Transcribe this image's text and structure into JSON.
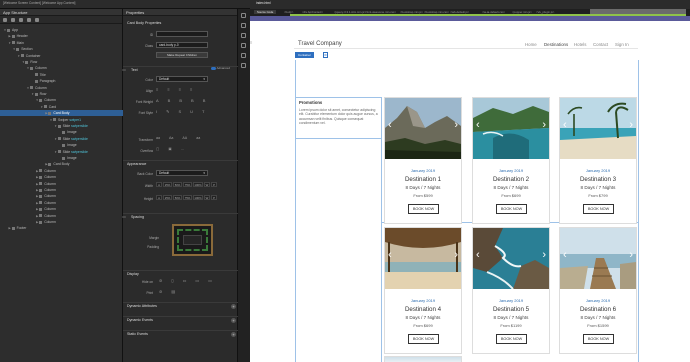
{
  "topbar": {
    "items": [
      "[Welcome Screen Content]",
      "[Welcome App Content]"
    ]
  },
  "left_panel": {
    "title": "App Structure",
    "rows": [
      {
        "label": "App",
        "indent": 0,
        "arrow": "▼"
      },
      {
        "label": "Header",
        "indent": 1,
        "arrow": "▶"
      },
      {
        "label": "Main",
        "indent": 1,
        "arrow": "▼"
      },
      {
        "label": "Section",
        "indent": 2,
        "arrow": "▼"
      },
      {
        "label": "Container",
        "indent": 3,
        "arrow": "▼"
      },
      {
        "label": "Row",
        "indent": 4,
        "arrow": "▼"
      },
      {
        "label": "Column",
        "indent": 5,
        "arrow": "▼"
      },
      {
        "label": "Title",
        "indent": 6,
        "arrow": ""
      },
      {
        "label": "Paragraph",
        "indent": 6,
        "arrow": ""
      },
      {
        "label": "Column",
        "indent": 5,
        "arrow": "▼"
      },
      {
        "label": "Row",
        "indent": 6,
        "arrow": "▼"
      },
      {
        "label": "Column",
        "indent": 7,
        "arrow": "▼"
      },
      {
        "label": "Card",
        "indent": 8,
        "arrow": "▼"
      },
      {
        "label": "Card Body",
        "indent": 9,
        "arrow": "▶",
        "selected": true
      },
      {
        "label": "Swiper",
        "suffix": "swiper1",
        "indent": 10,
        "arrow": "▼"
      },
      {
        "label": "Slide",
        "suffix": "swiperslide",
        "indent": 11,
        "arrow": "▼"
      },
      {
        "label": "Image",
        "indent": 12,
        "arrow": ""
      },
      {
        "label": "Slide",
        "suffix": "swiperslide",
        "indent": 11,
        "arrow": "▼"
      },
      {
        "label": "Image",
        "indent": 12,
        "arrow": ""
      },
      {
        "label": "Slide",
        "suffix": "swiperslide",
        "indent": 11,
        "arrow": "▼"
      },
      {
        "label": "Image",
        "indent": 12,
        "arrow": ""
      },
      {
        "label": "Card Body",
        "indent": 9,
        "arrow": "▶"
      },
      {
        "label": "Column",
        "indent": 7,
        "arrow": "▶"
      },
      {
        "label": "Column",
        "indent": 7,
        "arrow": "▶"
      },
      {
        "label": "Column",
        "indent": 7,
        "arrow": "▶"
      },
      {
        "label": "Column",
        "indent": 7,
        "arrow": "▶"
      },
      {
        "label": "Column",
        "indent": 7,
        "arrow": "▶"
      },
      {
        "label": "Column",
        "indent": 7,
        "arrow": "▶"
      },
      {
        "label": "Column",
        "indent": 7,
        "arrow": "▶"
      },
      {
        "label": "Column",
        "indent": 7,
        "arrow": "▶"
      },
      {
        "label": "Column",
        "indent": 7,
        "arrow": "▶"
      },
      {
        "label": "Footer",
        "indent": 1,
        "arrow": "▶"
      }
    ]
  },
  "props": {
    "title": "Properties",
    "card_body_properties": "Card Body Properties",
    "id_label": "ID",
    "id_value": "",
    "class_label": "Class",
    "class_value": "card-body p-0",
    "make_repeat_btn": "Make Repeat Children",
    "text_section": "Text",
    "advanced": "Advanced",
    "color_label": "Color",
    "color_value": "Default",
    "align_label": "Align",
    "font_weight_label": "Font Weight",
    "font_style_label": "Font Style",
    "transform_label": "Transform",
    "overflow_label": "Overflow",
    "appearance_section": "Appearance",
    "back_color_label": "Back Color",
    "back_color_value": "Default",
    "width_label": "Width",
    "height_label": "Height",
    "size_options": [
      "A",
      "25%",
      "50%",
      "75%",
      "100%",
      "W",
      "P"
    ],
    "spacing_section": "Spacing",
    "margin_label": "Margin",
    "padding_label": "Padding",
    "display_section": "Display",
    "hide_on_label": "Hide on",
    "print_label": "Print",
    "dynamic_attributes": "Dynamic Attributes",
    "dynamic_events": "Dynamic Events",
    "static_events": "Static Events"
  },
  "preview": {
    "file_tab": "index.html",
    "tabs": [
      "Source Code",
      "<body>",
      "<div.ApiContext>",
      "<jquery-3.3.1.slim.min.js>",
      "<font-awesome.min.css>",
      "<bootstrap.min.js>",
      "<bootstrap.min.css>",
      "<tab-default.js>",
      "<ta-ta-default.css>",
      "<popper.min.js>",
      "<Ve_plugin.js>"
    ],
    "brand": "Travel Company",
    "nav": [
      "Home",
      "Destinations",
      "Hotels",
      "Contact",
      "Sign In"
    ],
    "active_nav": "Destinations",
    "breadcrumb": "Container",
    "promo_title": "Promotions",
    "promo_body": "Lorem ipsum dolor sit amet, consectetur adipiscing elit. Curabitur elementum dolor quis augue cursus, a accumsan velit finibus. Quisque consequat condimentum vel.",
    "cards": [
      {
        "date": "January 2019",
        "dest": "Destination 1",
        "days": "8 Days / 7 Nights",
        "price": "From $599",
        "btn": "BOOK NOW",
        "scene": "yosemite"
      },
      {
        "date": "January 2019",
        "dest": "Destination 2",
        "days": "8 Days / 7 Nights",
        "price": "From $699",
        "btn": "BOOK NOW",
        "scene": "coast"
      },
      {
        "date": "January 2019",
        "dest": "Destination 3",
        "days": "8 Days / 7 Nights",
        "price": "From $799",
        "btn": "BOOK NOW",
        "scene": "beach"
      },
      {
        "date": "January 2019",
        "dest": "Destination 4",
        "days": "8 Days / 7 Nights",
        "price": "From $699",
        "btn": "BOOK NOW",
        "scene": "hut"
      },
      {
        "date": "January 2019",
        "dest": "Destination 5",
        "days": "8 Days / 7 Nights",
        "price": "From $1199",
        "btn": "BOOK NOW",
        "scene": "rocks"
      },
      {
        "date": "January 2019",
        "dest": "Destination 6",
        "days": "8 Days / 7 Nights",
        "price": "From $1599",
        "btn": "BOOK NOW",
        "scene": "pier"
      }
    ]
  },
  "colors": {
    "accent": "#2e6fbf",
    "selected_row": "#2e5f96",
    "date_blue": "#2b6cb0",
    "timeline_green": "#8fc24a",
    "timeline_purple": "#5a5a9a"
  }
}
